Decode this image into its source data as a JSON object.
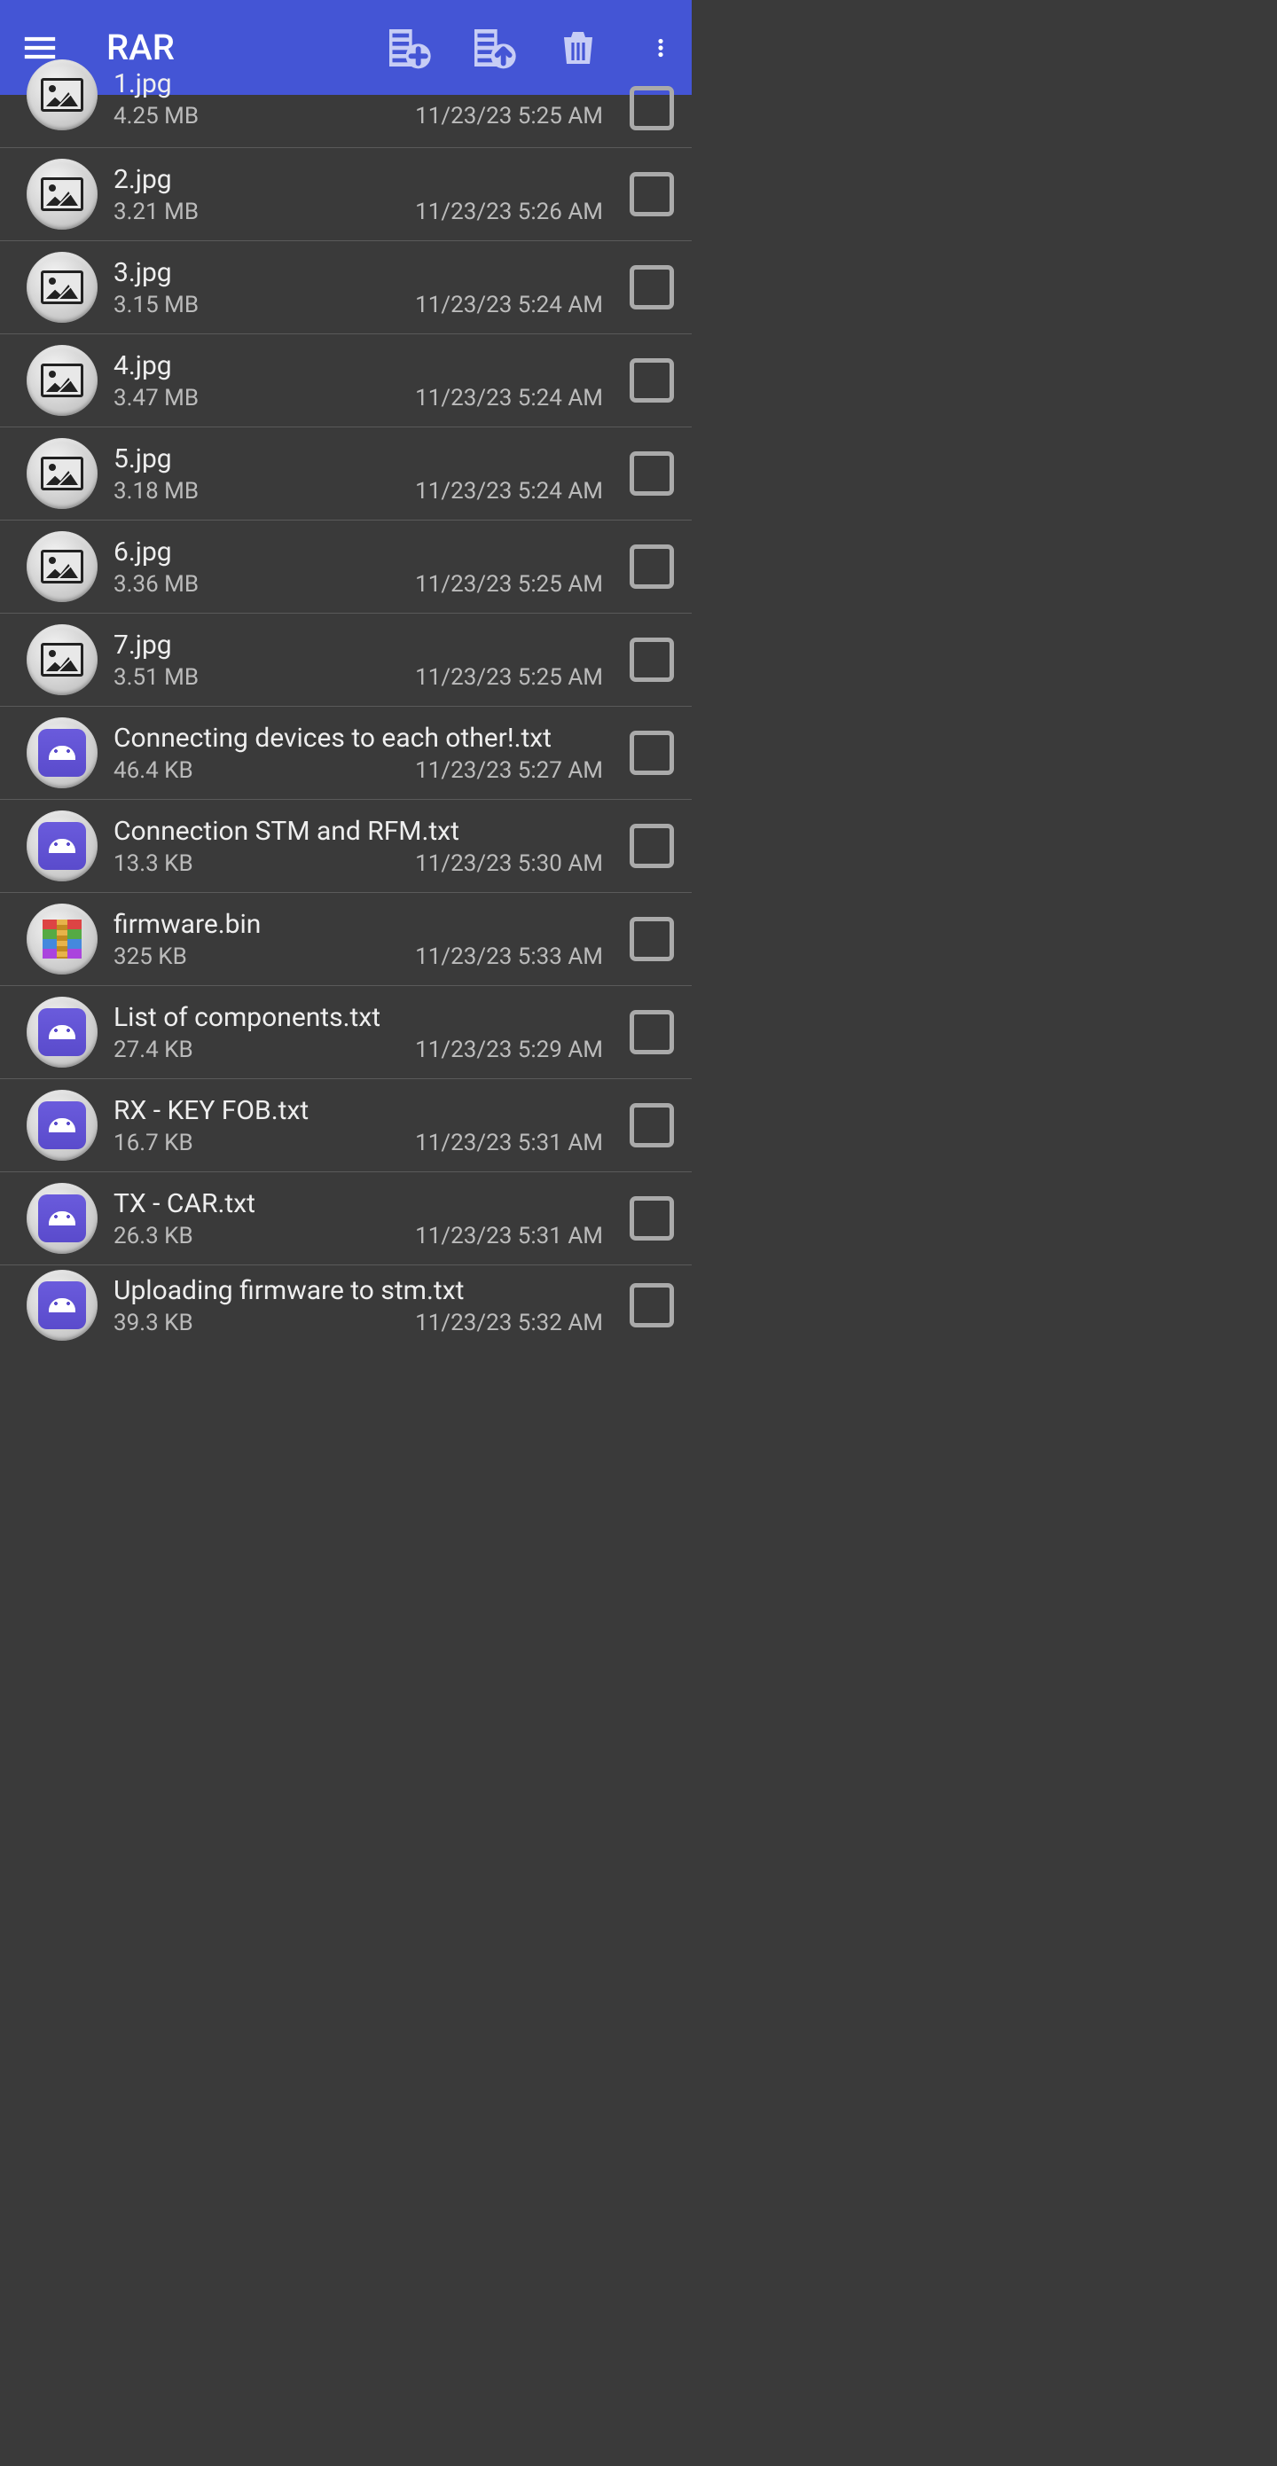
{
  "toolbar": {
    "title": "RAR"
  },
  "files": [
    {
      "name": "1.jpg",
      "size": "4.25 MB",
      "date": "11/23/23 5:25 AM",
      "icon": "image"
    },
    {
      "name": "2.jpg",
      "size": "3.21 MB",
      "date": "11/23/23 5:26 AM",
      "icon": "image"
    },
    {
      "name": "3.jpg",
      "size": "3.15 MB",
      "date": "11/23/23 5:24 AM",
      "icon": "image"
    },
    {
      "name": "4.jpg",
      "size": "3.47 MB",
      "date": "11/23/23 5:24 AM",
      "icon": "image"
    },
    {
      "name": "5.jpg",
      "size": "3.18 MB",
      "date": "11/23/23 5:24 AM",
      "icon": "image"
    },
    {
      "name": "6.jpg",
      "size": "3.36 MB",
      "date": "11/23/23 5:25 AM",
      "icon": "image"
    },
    {
      "name": "7.jpg",
      "size": "3.51 MB",
      "date": "11/23/23 5:25 AM",
      "icon": "image"
    },
    {
      "name": "Connecting devices to each other!.txt",
      "size": "46.4 KB",
      "date": "11/23/23 5:27 AM",
      "icon": "android"
    },
    {
      "name": "Connection STM and RFM.txt",
      "size": "13.3 KB",
      "date": "11/23/23 5:30 AM",
      "icon": "android"
    },
    {
      "name": "firmware.bin",
      "size": "325 KB",
      "date": "11/23/23 5:33 AM",
      "icon": "rar"
    },
    {
      "name": "List of components.txt",
      "size": "27.4 KB",
      "date": "11/23/23 5:29 AM",
      "icon": "android"
    },
    {
      "name": "RX - KEY FOB.txt",
      "size": "16.7 KB",
      "date": "11/23/23 5:31 AM",
      "icon": "android"
    },
    {
      "name": "TX - CAR.txt",
      "size": "26.3 KB",
      "date": "11/23/23 5:31 AM",
      "icon": "android"
    },
    {
      "name": "Uploading firmware to stm.txt",
      "size": "39.3 KB",
      "date": "11/23/23 5:32 AM",
      "icon": "android"
    }
  ]
}
